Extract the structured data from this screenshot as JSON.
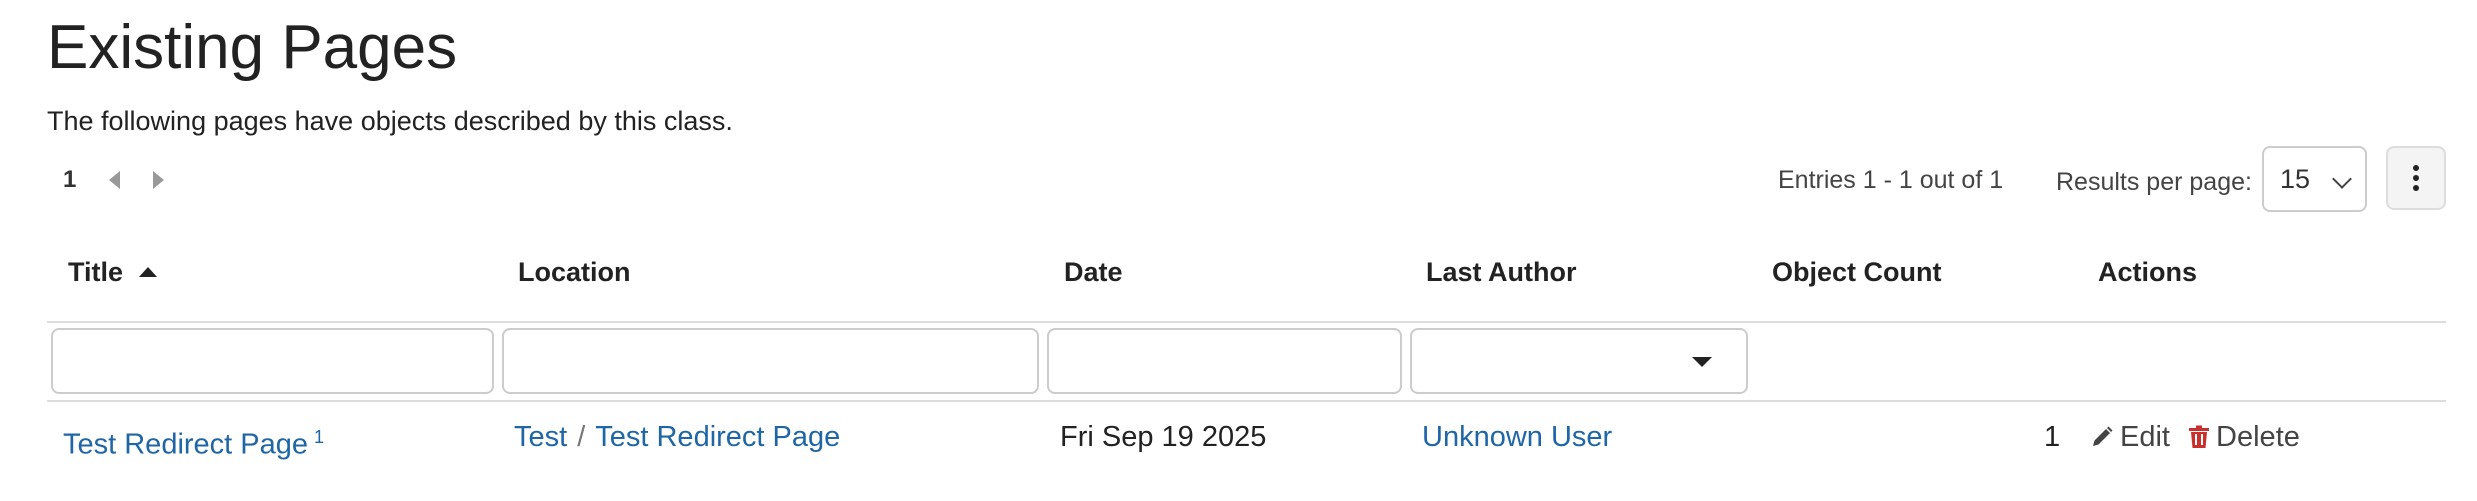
{
  "page": {
    "title": "Existing Pages",
    "description": "The following pages have objects described by this class."
  },
  "pagination": {
    "current_page": "1",
    "entries_text": "Entries 1 - 1 out of 1",
    "results_per_page_label": "Results per page:",
    "results_per_page_value": "15"
  },
  "table": {
    "columns": {
      "title": "Title",
      "location": "Location",
      "date": "Date",
      "last_author": "Last Author",
      "object_count": "Object Count",
      "actions": "Actions"
    },
    "sort": {
      "column": "Title",
      "direction": "ascending"
    },
    "rows": [
      {
        "title": "Test Redirect Page",
        "title_marker": "1",
        "location_parent": "Test",
        "location_separator": "/",
        "location_page": "Test Redirect Page",
        "date": "Fri Sep 19 2025",
        "last_author": "Unknown User",
        "object_count": "1",
        "edit_label": "Edit",
        "delete_label": "Delete"
      }
    ]
  },
  "icons": {
    "sort": "sort-ascending-icon",
    "prev": "chevron-left-icon",
    "next": "chevron-right-icon",
    "menu": "kebab-menu-icon",
    "edit": "pencil-icon",
    "delete": "trash-icon"
  },
  "colors": {
    "link": "#1f66a6",
    "delete_icon": "#c9302c",
    "text": "#222222",
    "border": "#cccccc"
  }
}
